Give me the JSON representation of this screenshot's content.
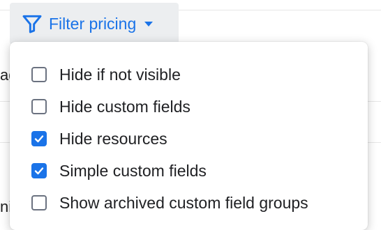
{
  "background": {
    "partial_text_1": "ag",
    "partial_text_2": "ni"
  },
  "filter_button": {
    "label": "Filter pricing",
    "icon": "filter-icon",
    "caret_icon": "caret-down-icon"
  },
  "menu": {
    "items": [
      {
        "label": "Hide if not visible",
        "checked": false
      },
      {
        "label": "Hide custom fields",
        "checked": false
      },
      {
        "label": "Hide resources",
        "checked": true
      },
      {
        "label": "Simple custom fields",
        "checked": true
      },
      {
        "label": "Show archived custom field groups",
        "checked": false
      }
    ]
  },
  "colors": {
    "accent": "#1a73e8",
    "button_bg": "#eceef0",
    "checkbox_border": "#6b7280",
    "text": "#202124"
  }
}
